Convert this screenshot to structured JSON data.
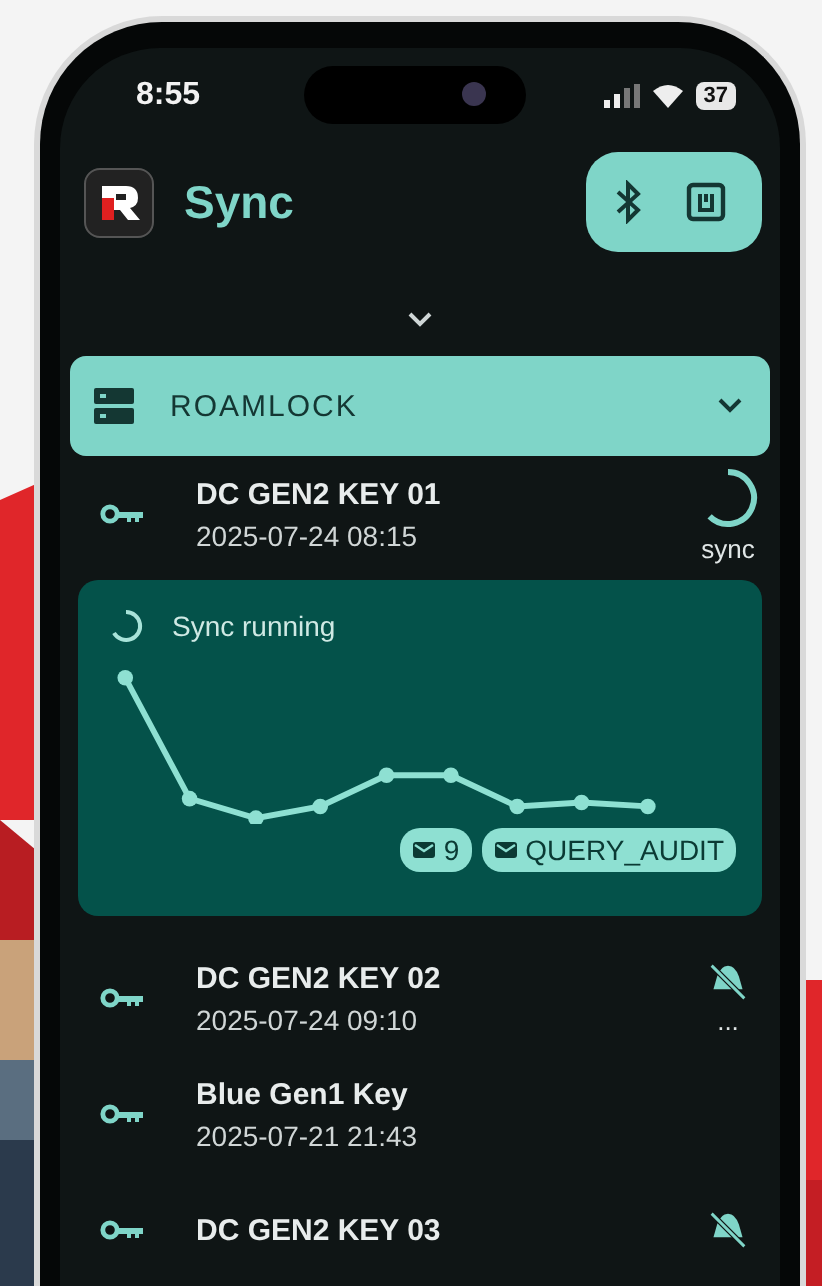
{
  "status_bar": {
    "time": "8:55",
    "battery": "37"
  },
  "header": {
    "title": "Sync"
  },
  "device_group": {
    "name": "ROAMLOCK",
    "expanded": false
  },
  "keys": [
    {
      "name": "DC GEN2 KEY 01",
      "time": "2025-07-24 08:15",
      "status": {
        "kind": "syncing",
        "label": "sync"
      },
      "sync_panel": {
        "title": "Sync running",
        "chips": [
          {
            "label": "9"
          },
          {
            "label": "QUERY_AUDIT"
          }
        ]
      }
    },
    {
      "name": "DC GEN2 KEY 02",
      "time": "2025-07-24 09:10",
      "status": {
        "kind": "offline",
        "label": "..."
      }
    },
    {
      "name": "Blue Gen1 Key",
      "time": "2025-07-21 21:43"
    },
    {
      "name": "DC GEN2 KEY 03",
      "status": {
        "kind": "offline"
      }
    }
  ]
}
